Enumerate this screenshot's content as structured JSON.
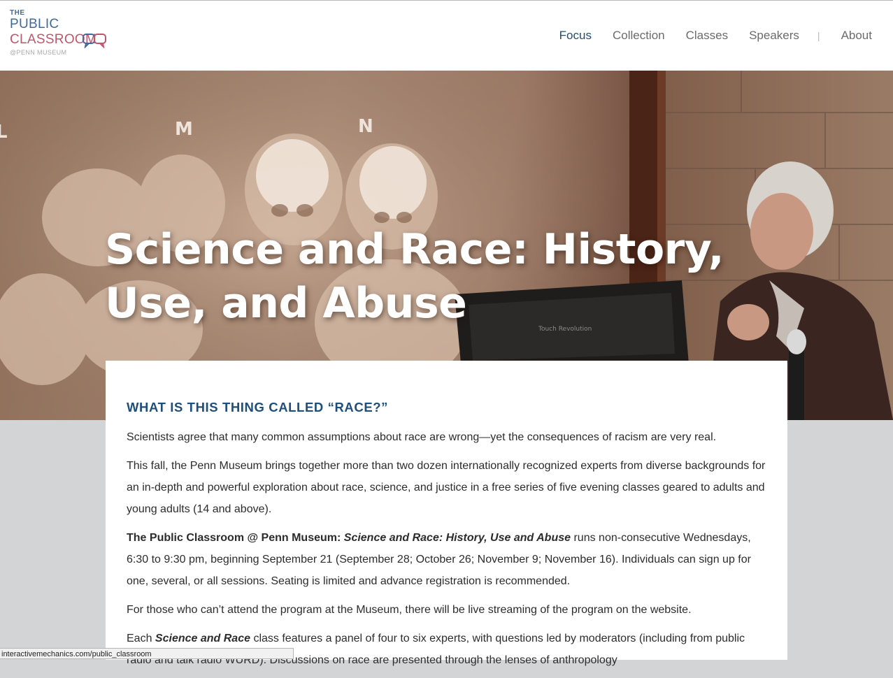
{
  "logo": {
    "line1": "THE",
    "line2": "PUBLIC",
    "line3": "CLASSROOM",
    "line4": "@PENN MUSEUM"
  },
  "nav": {
    "items": [
      {
        "label": "Focus",
        "active": true
      },
      {
        "label": "Collection",
        "active": false
      },
      {
        "label": "Classes",
        "active": false
      },
      {
        "label": "Speakers",
        "active": false
      },
      {
        "label": "About",
        "active": false
      }
    ],
    "separator": "|"
  },
  "hero": {
    "title": "Science and Race: History, Use, and Abuse",
    "slide_letters": [
      "L",
      "M",
      "N"
    ],
    "monitor_brand": "Touch Revolution"
  },
  "content": {
    "heading": "WHAT IS THIS THING CALLED “RACE?”",
    "p1": "Scientists agree that many common assumptions about race are wrong—yet the consequences of racism are very real.",
    "p2": "This fall, the Penn Museum brings together more than two dozen internationally recognized experts from diverse backgrounds for an in-depth and powerful exploration about race, science, and justice in a free series of five evening classes geared to adults and young adults (14 and above).",
    "p3_bold": "The Public Classroom @ Penn Museum: ",
    "p3_italic": "Science and Race: History, Use and Abuse",
    "p3_rest": " runs non-consecutive Wednesdays, 6:30 to 9:30 pm, beginning September 21 (September 28; October 26; November 9; November 16). Individuals can sign up for one, several, or all sessions. Seating is limited and advance registration is recommended.",
    "p4": "For those who can’t attend the program at the Museum, there will be live streaming of the program on the website.",
    "p5_start": "Each ",
    "p5_italic": "Science and Race",
    "p5_rest": " class features a panel of four to six experts, with questions led by moderators (including from public radio and talk radio WURD). Discussions on race are presented through the lenses of anthropology"
  },
  "statusbar": {
    "url": "interactivemechanics.com/public_classroom"
  },
  "colors": {
    "brand_blue": "#1e4e79",
    "logo_blue": "#3f6a9a",
    "logo_pink": "#c0566b",
    "page_gray": "#d3d4d6"
  }
}
